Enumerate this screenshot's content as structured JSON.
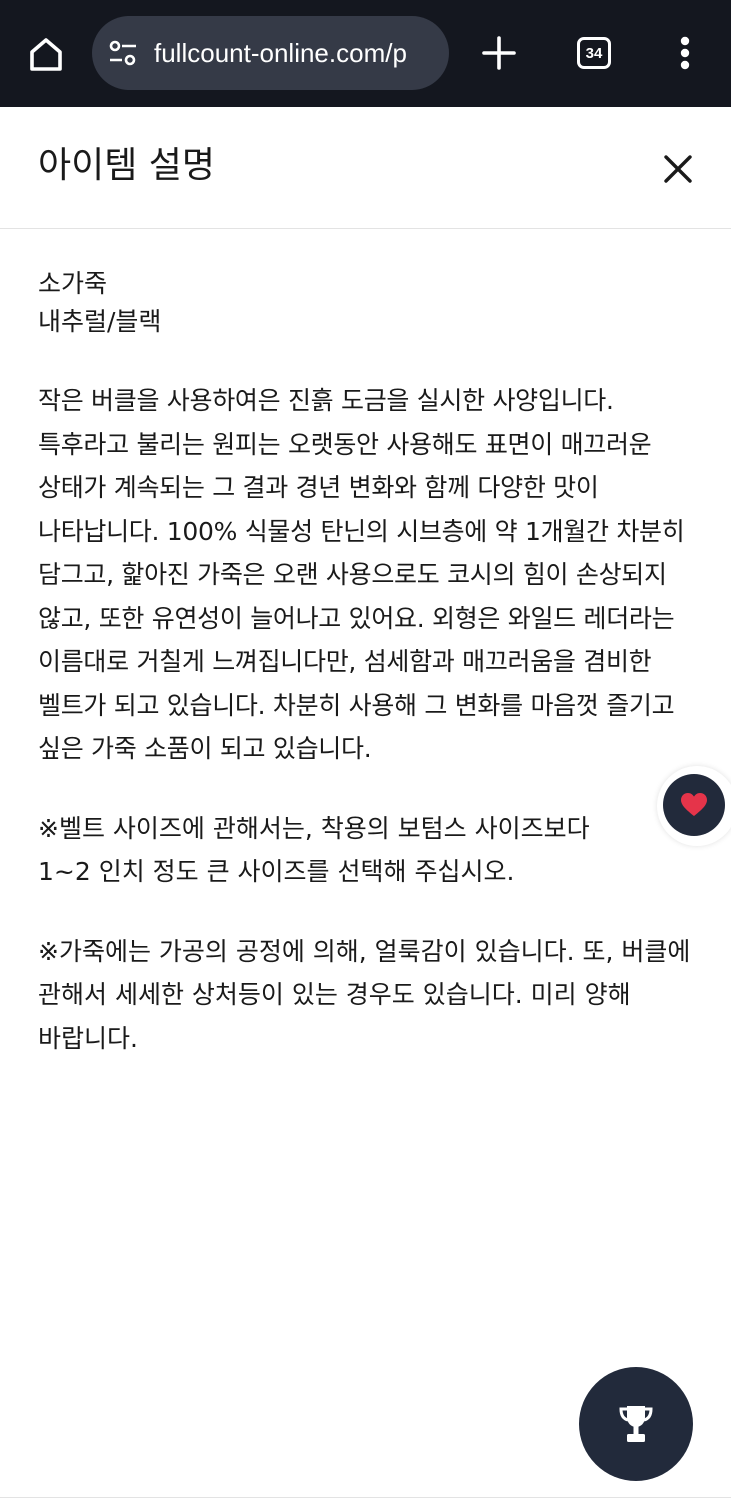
{
  "browser": {
    "url": "fullcount-online.com/p",
    "tab_count": "34",
    "icons": {
      "home": "home-icon",
      "site_settings": "tune-icon",
      "new_tab": "plus-icon",
      "menu": "more-vert-icon"
    }
  },
  "modal": {
    "title": "아이템 설명",
    "close_icon": "close-icon"
  },
  "description": {
    "material": "소가죽",
    "color": "내추럴/블랙",
    "body": "작은 버클을 사용하여은 진흙 도금을 실시한 사양입니다. 특후라고 불리는 원피는 오랫동안 사용해도 표면이 매끄러운 상태가 계속되는 그 결과 경년 변화와 함께 다양한 맛이 나타납니다. 100% 식물성 탄닌의 시브층에 약 1개월간 차분히 담그고, 핥아진 가죽은 오랜 사용으로도 코시의 힘이 손상되지 않고, 또한 유연성이 늘어나고 있어요. 외형은 와일드 레더라는 이름대로 거칠게 느껴집니다만, 섬세함과 매끄러움을 겸비한 벨트가 되고 있습니다. 차분히 사용해 그 변화를 마음껏 즐기고 싶은 가죽 소품이 되고 있습니다.",
    "size_note_line1": "※벨트 사이즈에 관해서는, 착용의 보텀스 사이즈보다",
    "size_note_line2": "1~2 인치 정도 큰 사이즈를 선택해 주십시오.",
    "leather_note": "※가죽에는 가공의 공정에 의해, 얼룩감이 있습니다. 또, 버클에 관해서 세세한 상처등이 있는 경우도 있습니다. 미리 양해 바랍니다."
  },
  "floating": {
    "favorite_icon": "heart-icon",
    "ranking_icon": "trophy-icon",
    "accent_color": "#222a3b",
    "heart_color": "#e5344a"
  }
}
